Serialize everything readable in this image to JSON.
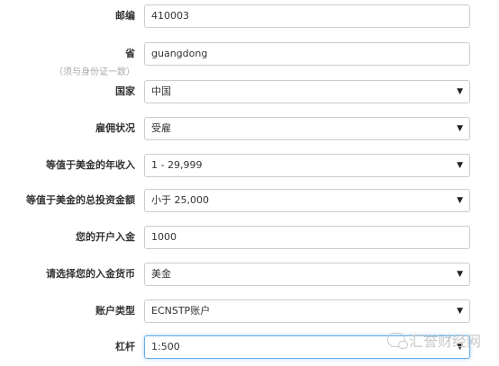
{
  "form": {
    "postcode": {
      "label": "邮编",
      "value": "410003"
    },
    "province": {
      "label": "省",
      "note": "（须与身份证一致）",
      "value": "guangdong"
    },
    "country": {
      "label": "国家",
      "value": "中国"
    },
    "employment": {
      "label": "雇佣状况",
      "value": "受雇"
    },
    "annual_income": {
      "label": "等值于美金的年收入",
      "value": "1 - 29,999"
    },
    "total_assets": {
      "label": "等值于美金的总投资金额",
      "value": "小于 25,000"
    },
    "initial_deposit": {
      "label": "您的开户入金",
      "value": "1000"
    },
    "deposit_currency": {
      "label": "请选择您的入金货币",
      "value": "美金"
    },
    "account_type": {
      "label": "账户类型",
      "value": "ECNSTP账户"
    },
    "leverage": {
      "label": "杠杆",
      "value": "1:500"
    }
  },
  "icons": {
    "dropdown_caret": "▼"
  },
  "watermark": {
    "text": "汇誉财经网"
  },
  "colors": {
    "focus_border": "#66afe9",
    "border": "#cccccc",
    "label": "#333333",
    "note": "#aaaaaa"
  }
}
